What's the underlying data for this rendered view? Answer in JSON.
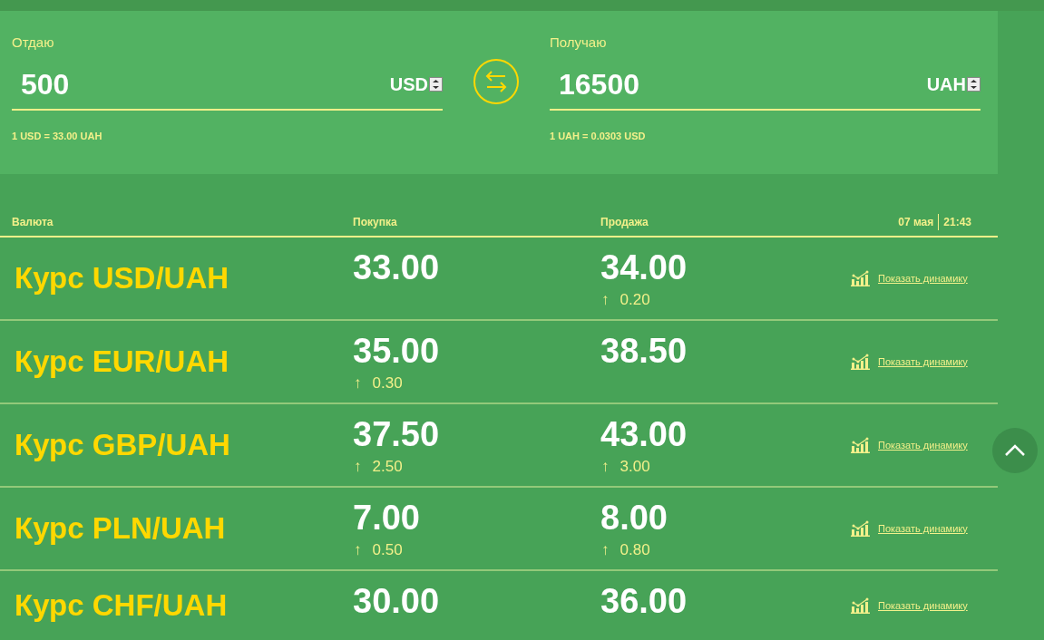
{
  "converter": {
    "give": {
      "label": "Отдаю",
      "value": "500",
      "currency": "USD",
      "rate": "1 USD = 33.00 UAH"
    },
    "get": {
      "label": "Получаю",
      "value": "16500",
      "currency": "UAH",
      "rate": "1 UAH = 0.0303 USD"
    }
  },
  "table": {
    "columns": [
      "Валюта",
      "Покупка",
      "Продажа"
    ],
    "date": "07 мая",
    "time": "21:43",
    "rows": [
      {
        "name": "Курс USD/UAH",
        "buy": "33.00",
        "sell": "34.00",
        "sell_change": {
          "arrow": "↑",
          "value": "0.20"
        },
        "link": "Показать динамику"
      },
      {
        "name": "Курс EUR/UAH",
        "buy": "35.00",
        "buy_change": {
          "arrow": "↑",
          "value": "0.30"
        },
        "sell": "38.50",
        "link": "Показать динамику"
      },
      {
        "name": "Курс GBP/UAH",
        "buy": "37.50",
        "buy_change": {
          "arrow": "↑",
          "value": "2.50"
        },
        "sell": "43.00",
        "sell_change": {
          "arrow": "↑",
          "value": "3.00"
        },
        "link": "Показать динамику"
      },
      {
        "name": "Курс PLN/UAH",
        "buy": "7.00",
        "buy_change": {
          "arrow": "↑",
          "value": "0.50"
        },
        "sell": "8.00",
        "sell_change": {
          "arrow": "↑",
          "value": "0.80"
        },
        "link": "Показать динамику"
      },
      {
        "name": "Курс CHF/UAH",
        "buy": "30.00",
        "sell": "36.00",
        "link": "Показать динамику"
      }
    ]
  }
}
